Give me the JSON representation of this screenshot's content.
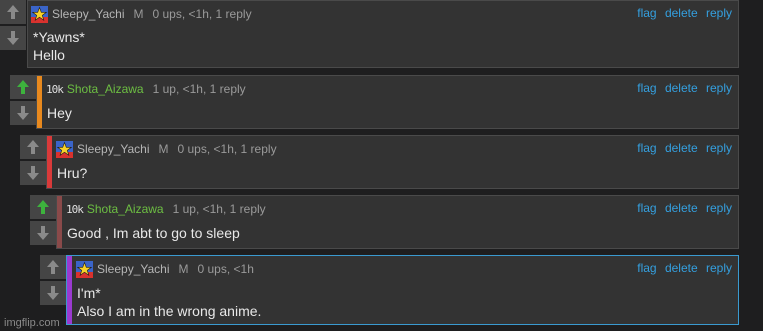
{
  "comments": [
    {
      "username": "Sleepy_Yachi",
      "mod_mark": "M",
      "meta": "0 ups, <1h, 1 reply",
      "text": "*Yawns*\nHello",
      "actions": {
        "flag": "flag",
        "delete": "delete",
        "reply": "reply"
      },
      "upvoted": false
    },
    {
      "badge": "10k",
      "username": "Shota_Aizawa",
      "meta": "1 up, <1h, 1 reply",
      "text": "Hey",
      "actions": {
        "flag": "flag",
        "delete": "delete",
        "reply": "reply"
      },
      "upvoted": true,
      "bar_color": "#e8891e"
    },
    {
      "username": "Sleepy_Yachi",
      "mod_mark": "M",
      "meta": "0 ups, <1h, 1 reply",
      "text": "Hru?",
      "actions": {
        "flag": "flag",
        "delete": "delete",
        "reply": "reply"
      },
      "upvoted": false,
      "bar_color": "#d93a3a"
    },
    {
      "badge": "10k",
      "username": "Shota_Aizawa",
      "meta": "1 up, <1h, 1 reply",
      "text": "Good , Im abt to go to sleep",
      "actions": {
        "flag": "flag",
        "delete": "delete",
        "reply": "reply"
      },
      "upvoted": true,
      "bar_color": "#8a4a4a"
    },
    {
      "username": "Sleepy_Yachi",
      "mod_mark": "M",
      "meta": "0 ups, <1h",
      "text": "I'm*\nAlso I am in the wrong anime.",
      "actions": {
        "flag": "flag",
        "delete": "delete",
        "reply": "reply"
      },
      "upvoted": false,
      "bar_color": "#9b3ad0"
    }
  ],
  "watermark": "imgflip.com",
  "colors": {
    "link": "#34a0e0",
    "upvote_active": "#3db33d",
    "username_green": "#6dbf43"
  }
}
